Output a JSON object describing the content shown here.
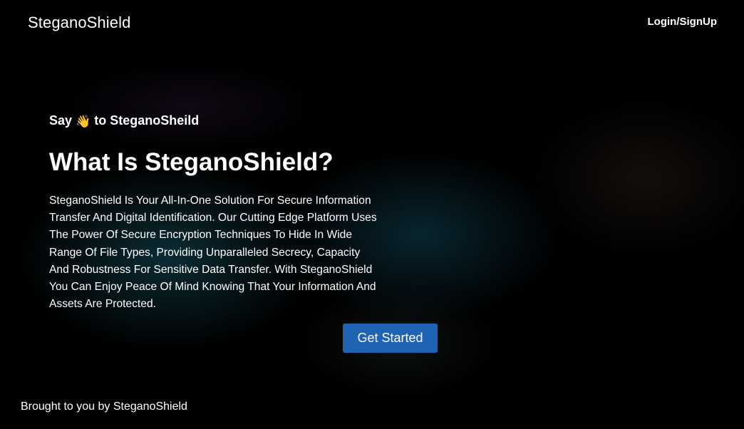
{
  "header": {
    "brand": "SteganoShield",
    "login_label": "Login/SignUp"
  },
  "hero": {
    "greeting_before": "Say",
    "greeting_icon": "waving-hand-icon",
    "greeting_emoji": "👋",
    "greeting_after": "to SteganoSheild",
    "title": "What Is SteganoShield?",
    "description": "SteganoShield Is Your All-In-One Solution For Secure Information Transfer And Digital Identification. Our Cutting Edge Platform Uses The Power Of Secure Encryption Techniques To Hide In Wide Range Of File Types, Providing Unparalleled Secrecy, Capacity And Robustness For Sensitive Data Transfer. With SteganoShield You Can Enjoy Peace Of Mind Knowing That Your Information And Assets Are Protected.",
    "cta_label": "Get Started"
  },
  "footer": {
    "text": "Brought to you by SteganoShield"
  },
  "colors": {
    "background": "#000000",
    "button": "#1e63b4",
    "text": "#ffffff"
  }
}
